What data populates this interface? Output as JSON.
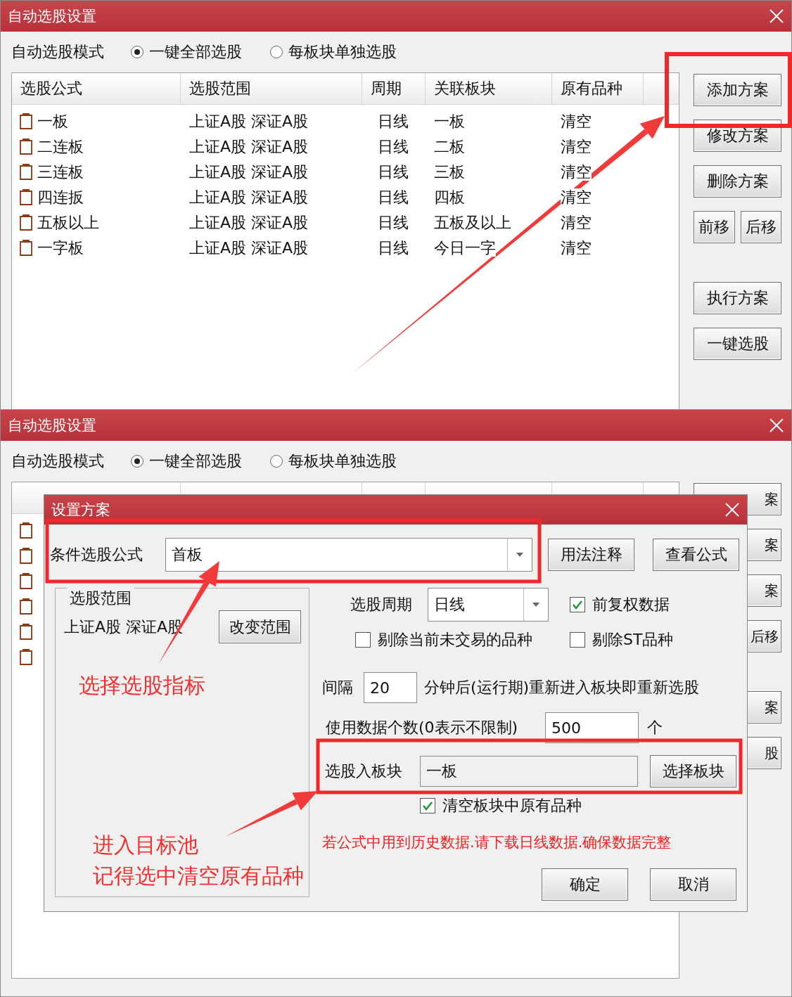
{
  "dialogs": [
    {
      "kind": "full",
      "title": "自动选股设置",
      "mode": {
        "label": "自动选股模式",
        "options": [
          {
            "label": "一键全部选股",
            "selected": true
          },
          {
            "label": "每板块单独选股",
            "selected": false
          }
        ]
      },
      "list": {
        "columns": [
          "选股公式",
          "选股范围",
          "周期",
          "关联板块",
          "原有品种"
        ],
        "rows": [
          {
            "kind": "full",
            "name": "一板",
            "range": "上证A股 深证A股",
            "period": "日线",
            "board": "一板",
            "original": "清空"
          },
          {
            "kind": "full",
            "name": "二连板",
            "range": "上证A股 深证A股",
            "period": "日线",
            "board": "二板",
            "original": "清空"
          },
          {
            "kind": "full",
            "name": "三连板",
            "range": "上证A股 深证A股",
            "period": "日线",
            "board": "三板",
            "original": "清空"
          },
          {
            "kind": "full",
            "name": "四连扳",
            "range": "上证A股 深证A股",
            "period": "日线",
            "board": "四板",
            "original": "清空"
          },
          {
            "kind": "full",
            "name": "五板以上",
            "range": "上证A股 深证A股",
            "period": "日线",
            "board": "五板及以上",
            "original": "清空"
          },
          {
            "kind": "full",
            "name": "一字板",
            "range": "上证A股 深证A股",
            "period": "日线",
            "board": "今日一字",
            "original": "清空"
          }
        ]
      },
      "buttons": [
        [
          {
            "label": "添加方案"
          }
        ],
        [
          {
            "label": "修改方案"
          }
        ],
        [
          {
            "label": "删除方案"
          }
        ],
        [
          {
            "label": "前移"
          },
          {
            "label": "后移"
          }
        ],
        [
          {
            "label": "执行方案"
          }
        ],
        [
          {
            "label": "一键选股"
          }
        ]
      ]
    },
    {
      "kind": "covered",
      "title": "自动选股设置",
      "mode": {
        "label": "自动选股模式",
        "options": [
          {
            "label": "一键全部选股",
            "selected": true
          },
          {
            "label": "每板块单独选股",
            "selected": false
          }
        ]
      },
      "list": {
        "rows": [
          {
            "kind": "covered"
          },
          {
            "kind": "covered"
          },
          {
            "kind": "covered"
          },
          {
            "kind": "covered"
          },
          {
            "kind": "covered"
          },
          {
            "kind": "covered"
          }
        ]
      },
      "buttons": [
        [
          {
            "label": "案"
          }
        ],
        [
          {
            "label": "案"
          }
        ],
        [
          {
            "label": "案"
          }
        ],
        [
          {
            "label": "后移"
          }
        ],
        [
          {
            "label": "案"
          }
        ],
        [
          {
            "label": "股"
          }
        ]
      ]
    }
  ],
  "modal": {
    "title": "设置方案",
    "formula": {
      "label": "条件选股公式",
      "value": "首板"
    },
    "formula_buttons": [
      "用法注释",
      "查看公式"
    ],
    "scope": {
      "legend": "选股范围",
      "value": "上证A股 深证A股",
      "button": "改变范围"
    },
    "period": {
      "label": "选股周期",
      "value": "日线"
    },
    "adjusted": {
      "label": "前复权数据",
      "checked": true
    },
    "exclude_untraded": {
      "label": "剔除当前未交易的品种",
      "checked": false
    },
    "exclude_st": {
      "label": "剔除ST品种",
      "checked": false
    },
    "interval": {
      "label": "间隔",
      "value": "20",
      "suffix": "分钟后(运行期)重新进入板块即重新选股"
    },
    "data_count": {
      "label": "使用数据个数(0表示不限制)",
      "value": "500",
      "suffix": "个"
    },
    "target": {
      "label": "选股入板块",
      "value": "一板",
      "button": "选择板块"
    },
    "clear_existing": {
      "label": "清空板块中原有品种",
      "checked": true
    },
    "warning": "若公式中用到历史数据.请下载日线数据.确保数据完整",
    "buttons": [
      "确定",
      "取消"
    ]
  },
  "callouts": [
    "选择选股指标",
    "进入目标池",
    "记得选中清空原有品种"
  ]
}
